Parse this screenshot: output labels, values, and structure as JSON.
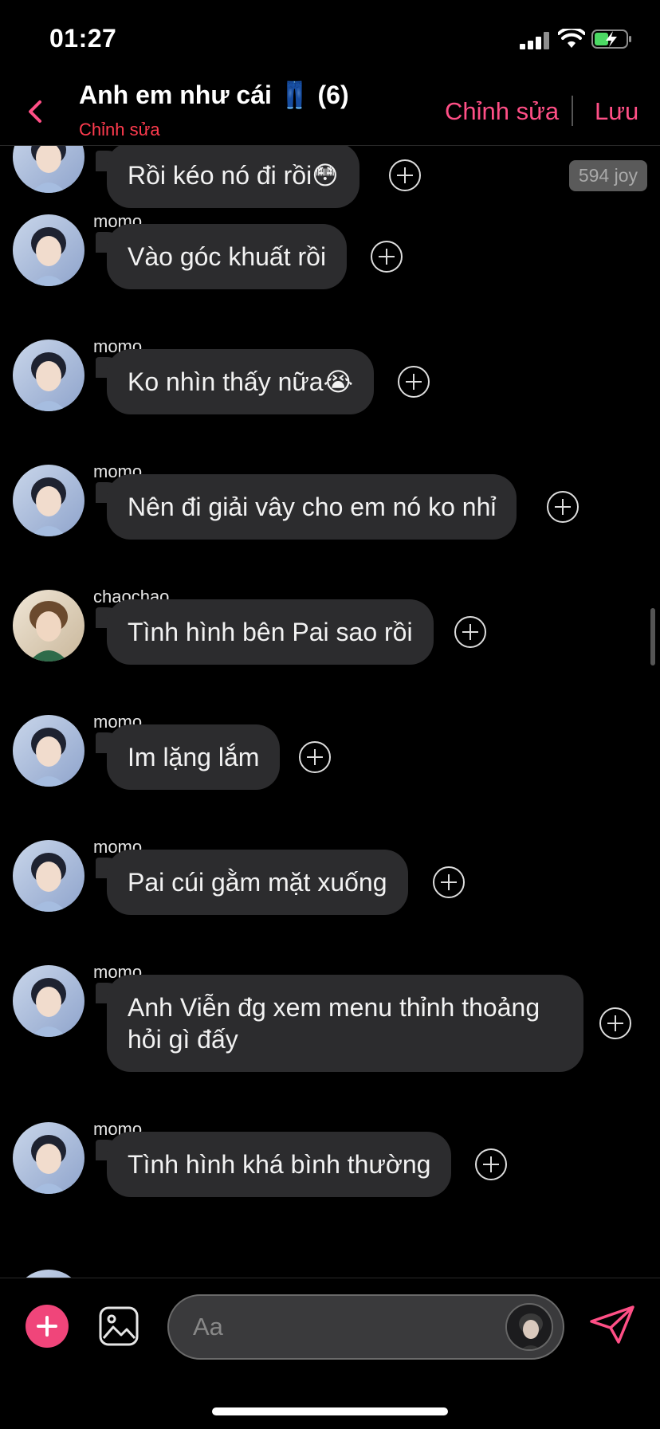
{
  "status": {
    "time": "01:27"
  },
  "header": {
    "title": "Anh em như cái 👖 (6)",
    "subtitle": "Chỉnh sửa",
    "edit_label": "Chỉnh sửa",
    "save_label": "Lưu"
  },
  "messages": [
    {
      "sender": "",
      "text": "Rồi kéo nó đi rồi😳",
      "badge": "594 joy"
    },
    {
      "sender": "momo",
      "text": "Vào góc khuất rồi"
    },
    {
      "sender": "momo",
      "text": "Ko nhìn thấy nữa😭"
    },
    {
      "sender": "momo",
      "text": "Nên đi giải vây cho em nó ko nhỉ"
    },
    {
      "sender": "chaochao",
      "text": "Tình hình bên Pai sao rồi"
    },
    {
      "sender": "momo",
      "text": "Im lặng lắm"
    },
    {
      "sender": "momo",
      "text": "Pai cúi gằm mặt xuống"
    },
    {
      "sender": "momo",
      "text": "Anh Viễn đg xem menu thỉnh thoảng hỏi gì đấy"
    },
    {
      "sender": "momo",
      "text": "Tình hình khá bình thường"
    }
  ],
  "composer": {
    "placeholder": "Aa"
  },
  "icons": {
    "back": "chevron-left-icon",
    "add": "plus-circle-icon",
    "image": "image-icon",
    "send": "send-icon",
    "message_action": "plus-circle-outline-icon"
  },
  "colors": {
    "accent": "#ff4f86",
    "subtitle": "#ff3b4e",
    "bubble": "#2c2c2e",
    "background": "#000000"
  }
}
